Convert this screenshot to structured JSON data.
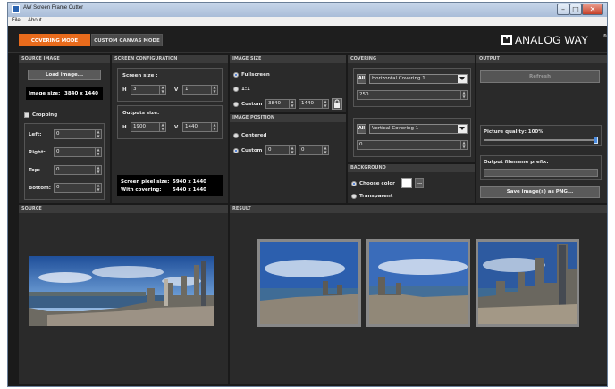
{
  "window": {
    "title": "AW Screen Frame Cutter"
  },
  "menu": [
    "File",
    "About"
  ],
  "mode_tabs": {
    "covering": "COVERING MODE",
    "canvas": "CUSTOM CANVAS MODE"
  },
  "brand": {
    "logo": "ANALOG WAY",
    "logo_mark": "®"
  },
  "source_image": {
    "header": "SOURCE IMAGE",
    "load_button": "Load image...",
    "image_size_label": "Image size:",
    "image_size_value": "3840 x 1440",
    "cropping_label": "Cropping",
    "crop": {
      "left_label": "Left:",
      "left": "0",
      "right_label": "Right:",
      "right": "0",
      "top_label": "Top:",
      "top": "0",
      "bottom_label": "Bottom:",
      "bottom": "0"
    }
  },
  "screen_config": {
    "header": "SCREEN CONFIGURATION",
    "screen_size_label": "Screen size :",
    "h_label": "H",
    "screen_h": "3",
    "v_label": "V",
    "screen_v": "1",
    "outputs_size_label": "Outputs size:",
    "out_h": "1900",
    "out_v": "1440",
    "screen_pixel_size_label": "Screen pixel size:",
    "screen_pixel_size_value": "5940 x 1440",
    "with_covering_label": "With covering:",
    "with_covering_value": "5440 x 1440"
  },
  "image_size": {
    "header": "IMAGE SIZE",
    "fullscreen": "Fullscreen",
    "one_to_one": "1:1",
    "custom": "Custom",
    "custom_w": "3840",
    "custom_h": "1440"
  },
  "image_position": {
    "header": "IMAGE POSITION",
    "centered": "Centered",
    "custom": "Custom",
    "x": "0",
    "y": "0"
  },
  "covering": {
    "header": "COVERING",
    "all_label": "All",
    "horizontal": "Horizontal Covering 1",
    "horizontal_value": "250",
    "vertical": "Vertical Covering 1",
    "vertical_value": "0"
  },
  "background": {
    "header": "BACKGROUND",
    "choose_color": "Choose color",
    "color_button": "...",
    "transparent": "Transparent",
    "color": "#ffffff"
  },
  "output": {
    "header": "OUTPUT",
    "refresh": "Refresh",
    "quality_label": "Picture quality: 100%",
    "quality": 1.0,
    "prefix_label": "Output filename prefix:",
    "prefix_value": "",
    "save_button": "Save image(s) as PNG..."
  },
  "source_panel": {
    "header": "SOURCE"
  },
  "result_panel": {
    "header": "RESULT"
  },
  "colors": {
    "accent": "#e86b1c",
    "panel": "#2a2a2a",
    "header": "#3b3b3b",
    "radio_active": "#2d6bd8"
  }
}
